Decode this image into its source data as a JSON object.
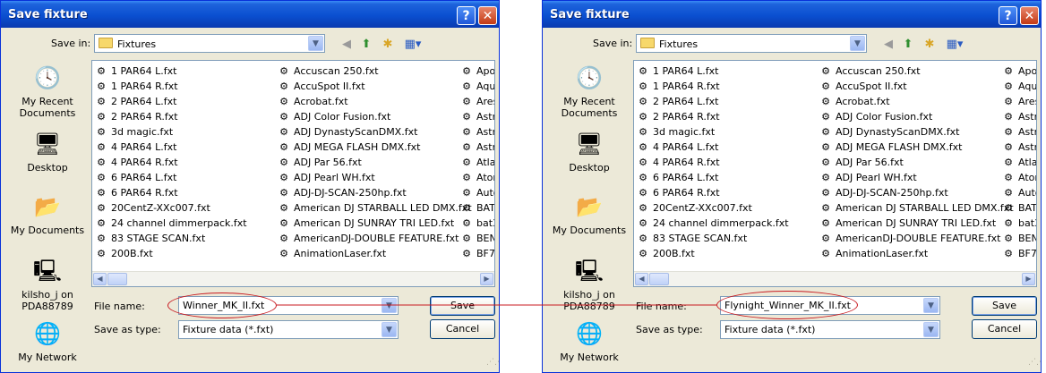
{
  "dialogs": [
    {
      "title": "Save fixture",
      "save_in_label": "Save in:",
      "save_in_value": "Fixtures",
      "places": [
        "My Recent Documents",
        "Desktop",
        "My Documents",
        "kilsho_j on PDA88789",
        "My Network"
      ],
      "file_name_label": "File name:",
      "file_name_value": "Winner_MK_II.fxt",
      "save_type_label": "Save as type:",
      "save_type_value": "Fixture data (*.fxt)",
      "save_button": "Save",
      "cancel_button": "Cancel"
    },
    {
      "title": "Save fixture",
      "save_in_label": "Save in:",
      "save_in_value": "Fixtures",
      "places": [
        "My Recent Documents",
        "Desktop",
        "My Documents",
        "kilsho_j on PDA88789",
        "My Network"
      ],
      "file_name_label": "File name:",
      "file_name_value": "Flynight_Winner_MK_II.fxt",
      "save_type_label": "Save as type:",
      "save_type_value": "Fixture data (*.fxt)",
      "save_button": "Save",
      "cancel_button": "Cancel"
    }
  ],
  "files": {
    "col1": [
      "1 PAR64 L.fxt",
      "1 PAR64 R.fxt",
      "2 PAR64 L.fxt",
      "2 PAR64 R.fxt",
      "3d magic.fxt",
      "4 PAR64 L.fxt",
      "4 PAR64 R.fxt",
      "6 PAR64 L.fxt",
      "6 PAR64 R.fxt",
      "20CentZ-XXc007.fxt",
      "24 channel dimmerpack.fxt",
      "83 STAGE SCAN.fxt",
      "200B.fxt"
    ],
    "col2": [
      "Accuscan 250.fxt",
      "AccuSpot II.fxt",
      "Acrobat.fxt",
      "ADJ Color Fusion.fxt",
      "ADJ DynastyScanDMX.fxt",
      "ADJ MEGA FLASH DMX.fxt",
      "ADJ Par 56.fxt",
      "ADJ Pearl WH.fxt",
      "ADJ-DJ-SCAN-250hp.fxt",
      "American DJ STARBALL LED DMX.fxt",
      "American DJ SUNRAY TRI LED.fxt",
      "AmericanDJ-DOUBLE FEATURE.fxt",
      "AnimationLaser.fxt"
    ],
    "col3": [
      "Apo",
      "Aqu",
      "Ares",
      "Astr",
      "Astr",
      "Astr",
      "Atla",
      "Aton",
      "Auto",
      "BAT",
      "bat3",
      "BEN",
      "BF7"
    ]
  },
  "icons": {
    "folder": "folder-icon",
    "back": "back-arrow-icon",
    "up": "up-folder-icon",
    "new_folder": "new-folder-icon",
    "views": "views-menu-icon",
    "fixture_file": "fixture-file-icon"
  },
  "colors": {
    "title_bar": "#0a4fd0",
    "annotation": "#c8191f"
  }
}
